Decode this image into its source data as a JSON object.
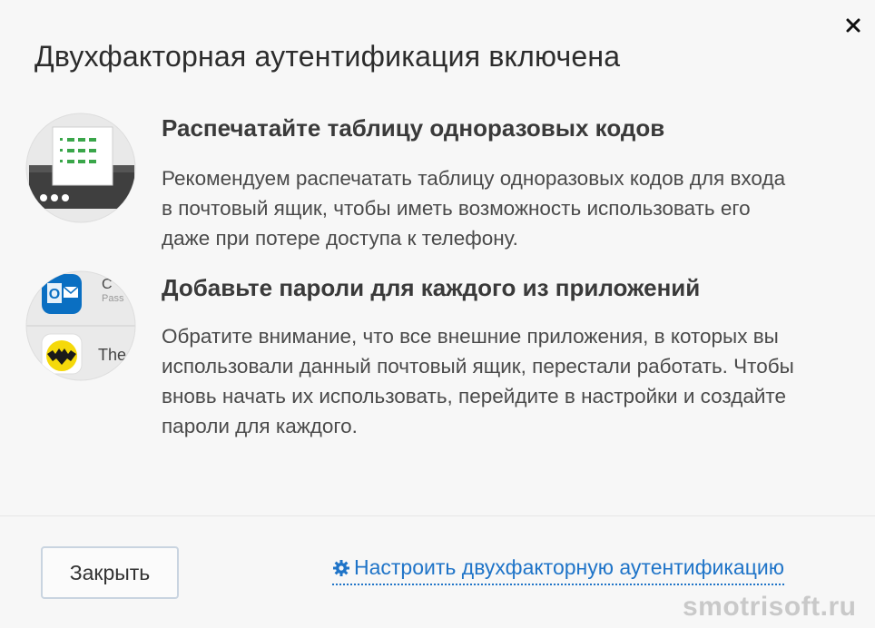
{
  "dialog": {
    "title": "Двухфакторная аутентификация включена",
    "close_icon": "close-icon"
  },
  "sections": [
    {
      "heading": "Распечатайте таблицу одноразовых кодов",
      "text_lines": [
        "Рекомендуем распечатать таблицу одноразовых кодов для входа",
        "в почтовый ящик, чтобы иметь возможность использовать его",
        "даже при потере доступа к телефону."
      ],
      "icon": "printer-illustration"
    },
    {
      "heading": "Добавьте пароли для каждого из приложений",
      "text_lines": [
        "Обратите внимание, что все внешние приложения, в которых вы",
        "использовали данный почтовый ящик, перестали работать. Чтобы",
        "вновь начать их использовать, перейдите в настройки и создайте",
        "пароли для каждого."
      ],
      "icon": "apps-illustration",
      "app_labels": [
        "O",
        "Pass",
        "The"
      ]
    }
  ],
  "footer": {
    "close_label": "Закрыть",
    "settings_label": "Настроить двухфакторную аутентификацию",
    "settings_icon": "gear-icon"
  },
  "watermark": "smotrisoft.ru",
  "colors": {
    "link": "#1f74c8",
    "outlook_blue": "#0a6fc2",
    "bat_yellow": "#f5d90a",
    "printer_dark": "#3f3f3f"
  }
}
